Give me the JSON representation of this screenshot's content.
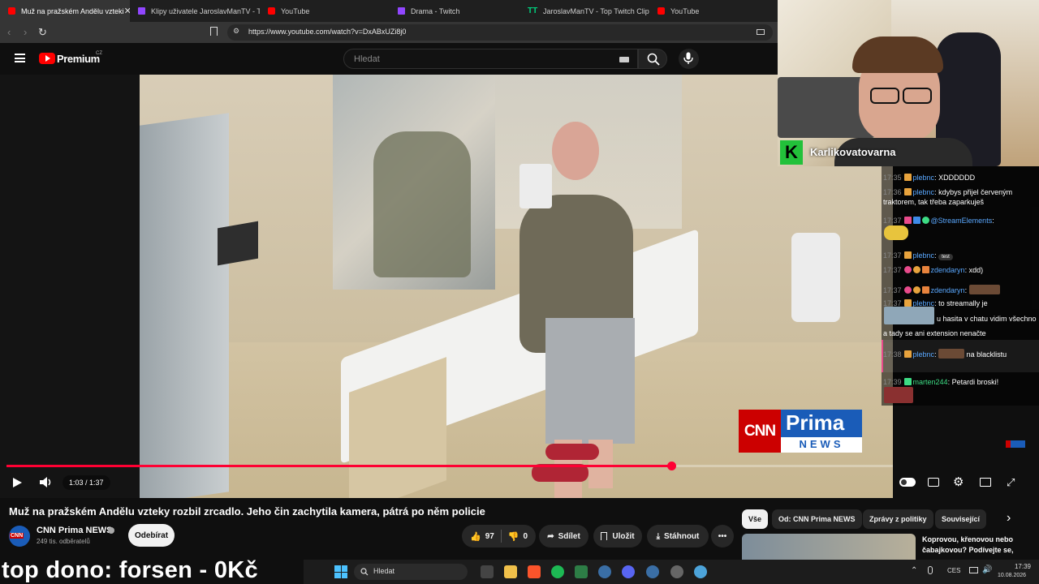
{
  "browser": {
    "tabs": [
      {
        "title": "Muž na pražském Andělu vzteki",
        "type": "yt",
        "active": true
      },
      {
        "title": "Klipy uživatele JaroslavManTV - Twi",
        "type": "tw"
      },
      {
        "title": "YouTube",
        "type": "yt"
      },
      {
        "title": "Drama - Twitch",
        "type": "tw"
      },
      {
        "title": "JaroslavManTV - Top Twitch Clips -",
        "type": "tt"
      },
      {
        "title": "YouTube",
        "type": "yt"
      }
    ],
    "url": "https://www.youtube.com/watch?v=DxABxUZi8j0"
  },
  "youtube": {
    "logo_text": "Premium",
    "logo_region": "CZ",
    "search_placeholder": "Hledat",
    "video": {
      "time": "1:03 / 1:37",
      "progress": 0.75,
      "watermark_top": "CNN",
      "watermark_brand": "Prima",
      "watermark_sub": "NEWS"
    },
    "title": "Muž na pražském Andělu vzteky rozbil zrcadlo. Jeho čin zachytila kamera, pátrá po něm policie",
    "channel": {
      "name": "CNN Prima NEWS",
      "subscribers": "249 tis. odběratelů",
      "avatar_text": "CNN",
      "subscribe_label": "Odebírat"
    },
    "actions": {
      "likes": "97",
      "dislikes": "0",
      "share": "Sdílet",
      "save": "Uložit",
      "download": "Stáhnout"
    },
    "chips": [
      "Vše",
      "Od: CNN Prima NEWS",
      "Zprávy z politiky",
      "Související"
    ],
    "suggestion_text": "Koprovou, křenovou nebo čabajkovou? Podívejte se,"
  },
  "stream": {
    "streamer_name": "Karlikovatovarna",
    "chat": [
      {
        "time": "17:35",
        "user": "pl​ebnc",
        "msg": "XDDDDDD"
      },
      {
        "time": "17:36",
        "user": "plebnc",
        "msg": "kdybys přijel červeným"
      },
      {
        "time": "",
        "user": "",
        "msg": "traktorem, tak třeba zaparkuješ"
      },
      {
        "time": "17:37",
        "user": "@StreamElements",
        "msg": ""
      },
      {
        "time": "17:37",
        "user": "plebnc",
        "msg": "test"
      },
      {
        "time": "17:37",
        "user": "zdendaryn",
        "msg": "xdd)"
      },
      {
        "time": "17:37",
        "user": "zdendaryn",
        "msg": ""
      },
      {
        "time": "17:37",
        "user": "plebnc",
        "msg": "to streamally je"
      },
      {
        "time": "",
        "user": "",
        "msg": "u hasita v chatu vidim všechno"
      },
      {
        "time": "",
        "user": "",
        "msg": "a tady se ani extension nenačte"
      },
      {
        "time": "17:38",
        "user": "plebnc",
        "msg": "na blacklistu"
      },
      {
        "time": "17:39",
        "user": "marten244",
        "msg": "Petardi broski!"
      }
    ],
    "donation_text": "top dono: forsen - 0Kč"
  },
  "taskbar": {
    "search_label": "Hledat",
    "language": "CES",
    "clock_time": "17:39",
    "clock_date": "10.08.2026"
  },
  "colors": {
    "youtube_red": "#ff0000",
    "progress_red": "#ff0033",
    "twitch_purple": "#9146ff",
    "cnn_red": "#cc0000"
  }
}
